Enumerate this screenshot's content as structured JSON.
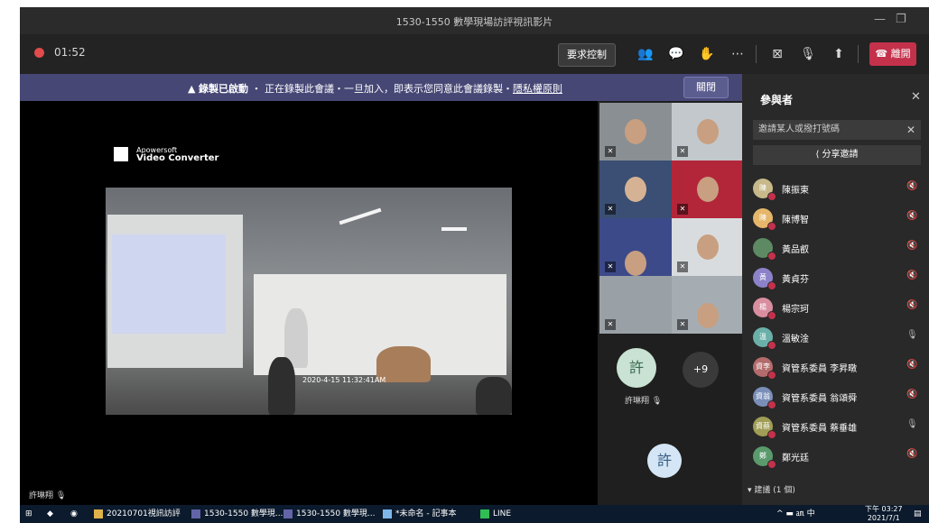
{
  "window": {
    "title": "1530-1550 數學現場訪評視訊影片",
    "min": "—",
    "max": "❐",
    "close": "✕"
  },
  "call": {
    "timer": "01:52",
    "request_control": "要求控制",
    "leave": "離開",
    "leave_icon": "☎",
    "icons": {
      "people": "people-icon",
      "chat": "chat-icon",
      "react": "reactions-icon",
      "more": "more-icon",
      "camera": "camera-off-icon",
      "mic": "mic-off-icon",
      "share": "share-tray-icon"
    }
  },
  "banner": {
    "bold": "錄製已啟動",
    "text": "・ 正在錄製此會議・一旦加入，即表示您同意此會議錄製・",
    "link": "隱私權原則",
    "close": "關閉",
    "icon": "▲"
  },
  "stage": {
    "watermark_brand": "Apowersoft",
    "watermark_product": "Video Converter",
    "timestamp_main": "2020-4-15 11:32:41",
    "timestamp_ampm": "AM",
    "presenter_label": "許琳翔"
  },
  "gallery": {
    "more_count": "+9",
    "initial": "許",
    "name": "許琳翔",
    "bottom_initial": "許"
  },
  "panel": {
    "title": "參與者",
    "invite_placeholder": "邀請某人或撥打號碼",
    "share_invite": "分享邀請",
    "participants": [
      {
        "name": "陳振東",
        "initial": "陳",
        "color": "#c7b98a",
        "mic": "muted"
      },
      {
        "name": "陳博智",
        "initial": "陳",
        "color": "#e6b66a",
        "mic": "muted"
      },
      {
        "name": "黃品叡",
        "initial": "",
        "color": "#5d8a63",
        "mic": "muted"
      },
      {
        "name": "黃貞芬",
        "initial": "黃",
        "color": "#8c82c9",
        "mic": "muted"
      },
      {
        "name": "楊宗珂",
        "initial": "楊",
        "color": "#d98ea0",
        "mic": "muted"
      },
      {
        "name": "溫敏淦",
        "initial": "溫",
        "color": "#6ab0a8",
        "mic": "on"
      },
      {
        "name": "資管系委員 李昇暾",
        "initial": "資李",
        "color": "#b36b6b",
        "mic": "muted"
      },
      {
        "name": "資管系委員 翁頌舜",
        "initial": "資翁",
        "color": "#7a8fb8",
        "mic": "muted"
      },
      {
        "name": "資管系委員 蔡垂雄",
        "initial": "資蔡",
        "color": "#a09d56",
        "mic": "on"
      },
      {
        "name": "鄭光廷",
        "initial": "鄭",
        "color": "#5a9a6c",
        "mic": "muted"
      }
    ],
    "suggested_header": "建議 (1 個)"
  },
  "taskbar": {
    "items": [
      "20210701視訊訪評",
      "1530-1550 數學現...",
      "1530-1550 數學現...",
      "*未命名 - 記事本",
      "LINE"
    ],
    "tray": "^ ▬ ㏂ 中",
    "time": "下午 03:27",
    "date": "2021/7/1"
  }
}
